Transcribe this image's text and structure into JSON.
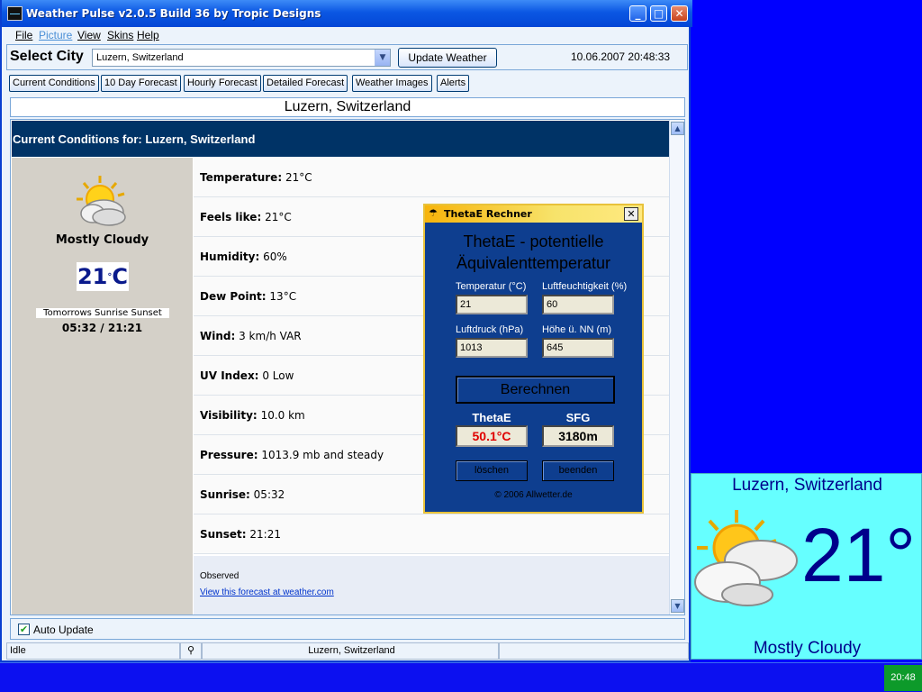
{
  "window": {
    "title": "Weather Pulse v2.0.5 Build 36 by Tropic Designs",
    "controls": {
      "minimize": "_",
      "maximize": "□",
      "close": "✕"
    }
  },
  "menu": [
    {
      "label": "File",
      "enabled": true
    },
    {
      "label": "Picture",
      "enabled": false
    },
    {
      "label": "View",
      "enabled": true
    },
    {
      "label": "Skins",
      "enabled": true
    },
    {
      "label": "Help",
      "enabled": true
    }
  ],
  "city_bar": {
    "label": "Select City",
    "selected_city": "Luzern, Switzerland",
    "dropdown_arrow": "▼",
    "update_button": "Update Weather",
    "datetime": "10.06.2007 20:48:33"
  },
  "tabs": [
    "Current Conditions",
    "10 Day Forecast",
    "Hourly Forecast",
    "Detailed Forecast",
    "Weather Images",
    "Alerts"
  ],
  "location_header": "Luzern, Switzerland",
  "current": {
    "header": "Current Conditions for: Luzern, Switzerland",
    "icon": "partly-cloudy-icon",
    "condition": "Mostly Cloudy",
    "temp_value": "21",
    "temp_degree": "°",
    "temp_unit": "C",
    "sun_label": "Tomorrows Sunrise Sunset",
    "sun_times": "05:32 / 21:21",
    "rows": [
      {
        "label": "Temperature:",
        "value": "21°C"
      },
      {
        "label": "Feels like:",
        "value": "21°C"
      },
      {
        "label": "Humidity:",
        "value": "60%"
      },
      {
        "label": "Dew Point:",
        "value": "13°C"
      },
      {
        "label": "Wind:",
        "value": "3 km/h VAR"
      },
      {
        "label": "UV Index:",
        "value": "0 Low"
      },
      {
        "label": "Visibility:",
        "value": "10.0 km"
      },
      {
        "label": "Pressure:",
        "value": "1013.9 mb and steady"
      },
      {
        "label": "Sunrise:",
        "value": "05:32"
      },
      {
        "label": "Sunset:",
        "value": "21:21"
      }
    ],
    "observed_label": "Observed",
    "forecast_link": "View this forecast at weather.com"
  },
  "auto_update": {
    "label": "Auto Update",
    "checked": true,
    "check_mark": "✔"
  },
  "status_bar": {
    "state": "Idle",
    "city": "Luzern, Switzerland"
  },
  "dialog": {
    "title": "ThetaE Rechner",
    "close": "✕",
    "heading_line1": "ThetaE - potentielle",
    "heading_line2": "Äquivalenttemperatur",
    "fields": [
      {
        "label": "Temperatur (°C)",
        "value": "21"
      },
      {
        "label": "Luftfeuchtigkeit (%)",
        "value": "60"
      },
      {
        "label": "Luftdruck (hPa)",
        "value": "1013"
      },
      {
        "label": "Höhe ü. NN (m)",
        "value": "645"
      }
    ],
    "calc_button": "Berechnen",
    "results": [
      {
        "label": "ThetaE",
        "value": "50.1°C",
        "color": "#e00000"
      },
      {
        "label": "SFG",
        "value": "3180m",
        "color": "#000000"
      }
    ],
    "clear_button": "löschen",
    "exit_button": "beenden",
    "copyright": "© 2006 Allwetter.de"
  },
  "widget": {
    "city": "Luzern, Switzerland",
    "temp": "21°",
    "condition": "Mostly Cloudy",
    "icon": "partly-cloudy-icon"
  },
  "taskbar": {
    "clock": "20:48"
  },
  "colors": {
    "header_navy": "#003366",
    "widget_cyan": "#66ffff",
    "widget_text": "#00008b",
    "dialog_blue": "#0e3e8f"
  }
}
